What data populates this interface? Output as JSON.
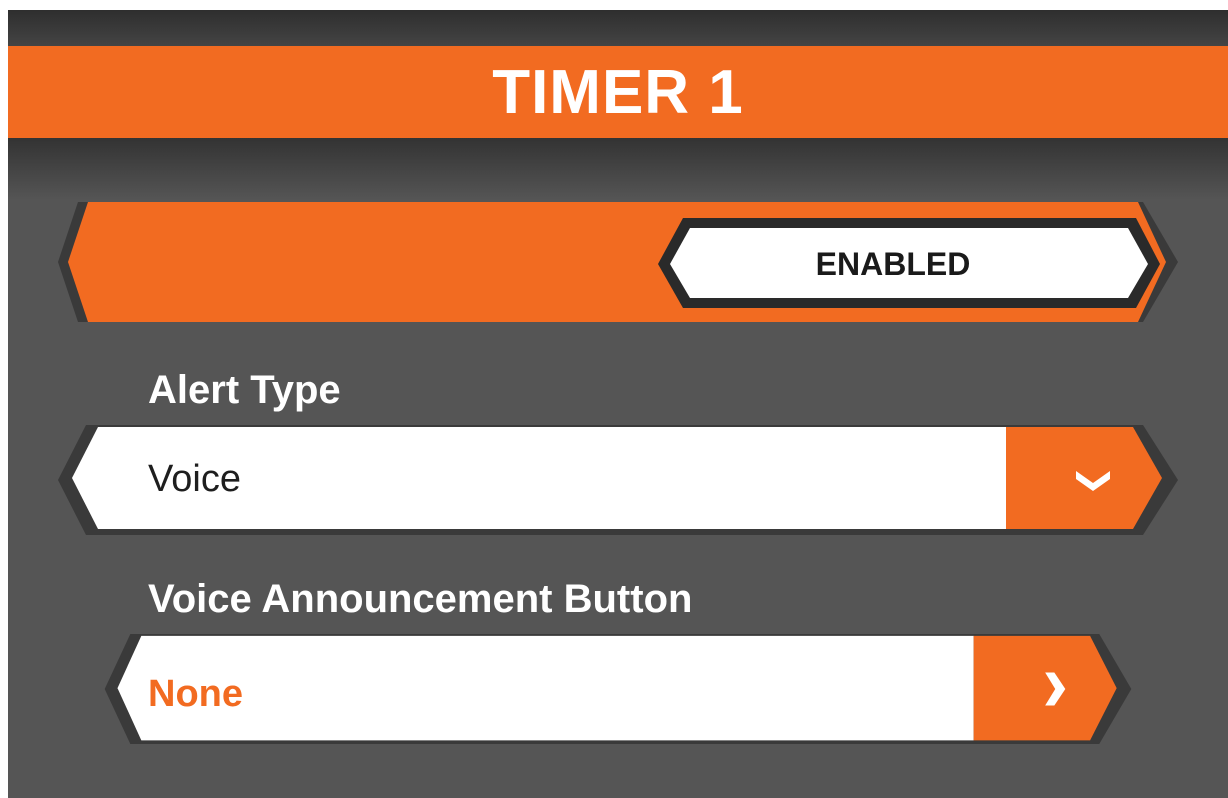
{
  "header": {
    "title": "TIMER 1"
  },
  "enable_toggle": {
    "state_label": "ENABLED"
  },
  "alert_type": {
    "label": "Alert Type",
    "selected_value": "Voice",
    "control_icon": "chevron-down-icon"
  },
  "voice_announcement_button": {
    "label": "Voice Announcement Button",
    "value": "None",
    "control_icon": "chevron-right-icon"
  },
  "colors": {
    "accent": "#f26b21",
    "background": "#555555",
    "dark_band": "#333333",
    "field_bg": "#ffffff",
    "text_light": "#ffffff",
    "text_dark": "#1e1e1e"
  }
}
